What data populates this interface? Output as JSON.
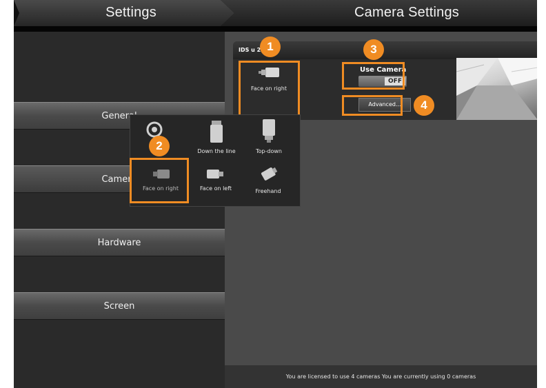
{
  "header": {
    "left_title": "Settings",
    "right_title": "Camera Settings"
  },
  "sidebar": {
    "items": [
      {
        "label": "General"
      },
      {
        "label": "Camera"
      },
      {
        "label": "Hardware"
      },
      {
        "label": "Screen"
      }
    ]
  },
  "camera_card": {
    "title": "IDS u  2xLE-C",
    "view_label": "Face on right",
    "use_camera_label": "Use Camera",
    "toggle_state": "OFF",
    "advanced_label": "Advanced..."
  },
  "view_popup": {
    "options": [
      {
        "label": "Down the line",
        "icon": "camera-down-the-line-icon"
      },
      {
        "label": "Top-down",
        "icon": "camera-top-down-icon"
      },
      {
        "label": "Face on right",
        "icon": "camera-face-on-right-icon"
      },
      {
        "label": "Face on left",
        "icon": "camera-face-on-left-icon"
      },
      {
        "label": "Freehand",
        "icon": "camera-freehand-icon"
      }
    ]
  },
  "badges": [
    "1",
    "2",
    "3",
    "4"
  ],
  "footer": {
    "license_text": "You are licensed to use 4 cameras   You are currently using 0 cameras"
  },
  "colors": {
    "highlight": "#f08c23",
    "background": "#1c1c1c",
    "panel": "#4a4a4a"
  }
}
